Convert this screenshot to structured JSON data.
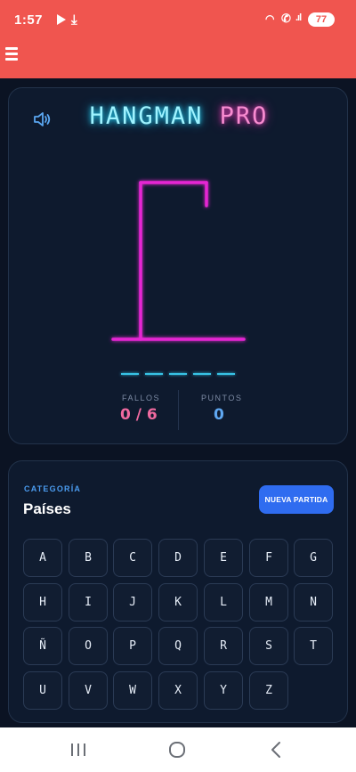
{
  "status": {
    "time": "1:57",
    "battery": "77"
  },
  "game": {
    "title_part1": "HANGMAN",
    "title_part2": "PRO",
    "word_slots": 5,
    "errors_label": "FALLOS",
    "errors_value": "0 / 6",
    "points_label": "PUNTOS",
    "points_value": "0"
  },
  "keyboard": {
    "category_label": "CATEGORÍA",
    "category_value": "Países",
    "new_game_label": "NUEVA PARTIDA",
    "letters": [
      "A",
      "B",
      "C",
      "D",
      "E",
      "F",
      "G",
      "H",
      "I",
      "J",
      "K",
      "L",
      "M",
      "N",
      "Ñ",
      "O",
      "P",
      "Q",
      "R",
      "S",
      "T",
      "U",
      "V",
      "W",
      "X",
      "Y",
      "Z"
    ]
  },
  "colors": {
    "accent_red": "#f0554f",
    "neon_magenta": "#e526d3",
    "neon_cyan": "#37c3e6",
    "errors_pink": "#f06aa0",
    "points_blue": "#5fa8f2",
    "button_blue": "#2f6cf0"
  },
  "icons": [
    "menu-icon",
    "sound-icon",
    "nav-recents-icon",
    "nav-home-icon",
    "nav-back-icon"
  ]
}
